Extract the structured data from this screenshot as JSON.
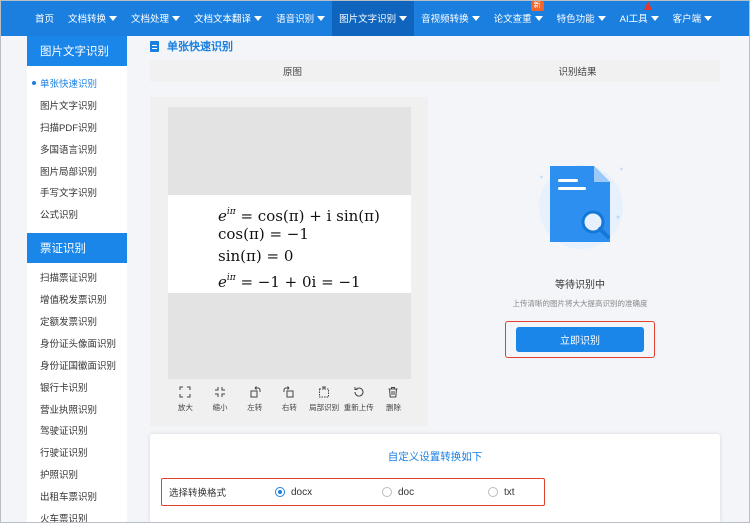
{
  "nav": {
    "items": [
      {
        "label": "首页",
        "caret": false
      },
      {
        "label": "文档转换",
        "caret": true
      },
      {
        "label": "文档处理",
        "caret": true
      },
      {
        "label": "文档文本翻译",
        "caret": true
      },
      {
        "label": "语音识别",
        "caret": true
      },
      {
        "label": "图片文字识别",
        "caret": true,
        "active": true
      },
      {
        "label": "音视频转换",
        "caret": true
      },
      {
        "label": "论文查重",
        "caret": true,
        "badge": "新"
      },
      {
        "label": "特色功能",
        "caret": true
      },
      {
        "label": "AI工具",
        "caret": true,
        "hot": true
      },
      {
        "label": "客户端",
        "caret": true
      }
    ]
  },
  "sidebar": {
    "section1_title": "图片文字识别",
    "section1_items": [
      "单张快速识别",
      "图片文字识别",
      "扫描PDF识别",
      "多国语言识别",
      "图片局部识别",
      "手写文字识别",
      "公式识别"
    ],
    "section2_title": "票证识别",
    "section2_items": [
      "扫描票证识别",
      "增值税发票识别",
      "定额发票识别",
      "身份证头像面识别",
      "身份证国徽面识别",
      "银行卡识别",
      "营业执照识别",
      "驾驶证识别",
      "行驶证识别",
      "护照识别",
      "出租车票识别",
      "火车票识别"
    ]
  },
  "main": {
    "title": "单张快速识别",
    "col_original": "原图",
    "col_result": "识别结果"
  },
  "preview": {
    "math_lines": [
      {
        "base": "e",
        "sup": "iπ",
        "rest": " = cos(π) + i sin(π)"
      },
      {
        "base": "",
        "sup": "",
        "rest": "cos(π) = −1"
      },
      {
        "base": "",
        "sup": "",
        "rest": "sin(π) = 0"
      },
      {
        "base": "e",
        "sup": "iπ",
        "rest": " = −1 + 0i = −1"
      }
    ]
  },
  "toolbar": {
    "zoom_in": "放大",
    "zoom_out": "缩小",
    "rotate_left": "左转",
    "rotate_right": "右转",
    "partial": "局部识别",
    "reupload": "重新上传",
    "delete": "删除"
  },
  "result": {
    "status": "等待识别中",
    "hint": "上传清晰的图片将大大提高识别的准确度",
    "button": "立即识别"
  },
  "settings": {
    "title": "自定义设置转换如下",
    "format_label": "选择转换格式",
    "options": [
      "docx",
      "doc",
      "txt"
    ],
    "selected": "docx"
  },
  "colors": {
    "primary": "#1b7fe0",
    "highlight_border": "#e0412f"
  }
}
